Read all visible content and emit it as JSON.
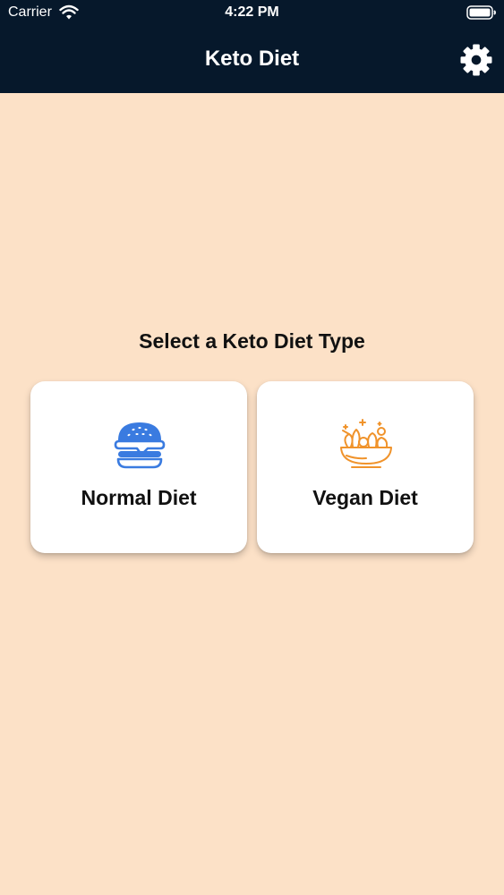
{
  "status_bar": {
    "carrier": "Carrier",
    "time": "4:22 PM"
  },
  "nav": {
    "title": "Keto Diet",
    "settings_icon": "gear-icon"
  },
  "main": {
    "heading": "Select a Keto Diet Type",
    "cards": [
      {
        "label": "Normal Diet",
        "icon": "burger-icon",
        "icon_color": "#3a7be0"
      },
      {
        "label": "Vegan Diet",
        "icon": "salad-bowl-icon",
        "icon_color": "#f0932b"
      }
    ]
  },
  "colors": {
    "header_bg": "#06182b",
    "page_bg": "#fce1c7",
    "card_bg": "#ffffff"
  }
}
